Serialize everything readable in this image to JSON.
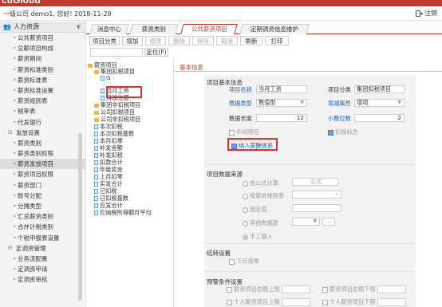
{
  "banner": {
    "title": "ctiGloud"
  },
  "header": {
    "welcome": "一级公司 demo1, 您好! 2018-11-29",
    "logout_label": "注销"
  },
  "sidebar": {
    "title": "人力资源",
    "items": [
      {
        "label": "公共薪资项目",
        "level": 2
      },
      {
        "label": "总额项目构成",
        "level": 2
      },
      {
        "label": "薪资期间",
        "level": 2
      },
      {
        "label": "薪资标准类别",
        "level": 2
      },
      {
        "label": "薪资标准表",
        "level": 2
      },
      {
        "label": "薪资标准设置",
        "level": 2
      },
      {
        "label": "薪资规则表",
        "level": 2
      },
      {
        "label": "税率表",
        "level": 2
      },
      {
        "label": "代发银行",
        "level": 2
      },
      {
        "label": "发放设置",
        "level": 1
      },
      {
        "label": "薪资类别",
        "level": 2
      },
      {
        "label": "薪资类别权限",
        "level": 2
      },
      {
        "label": "薪资发放项目",
        "level": 2,
        "active": true
      },
      {
        "label": "薪资项目权限",
        "level": 2
      },
      {
        "label": "薪资部门",
        "level": 2
      },
      {
        "label": "账号分配",
        "level": 2
      },
      {
        "label": "分摊类型",
        "level": 2
      },
      {
        "label": "汇总薪资类别",
        "level": 2
      },
      {
        "label": "合并计税类别",
        "level": 2
      },
      {
        "label": "个税申报表设置",
        "level": 2
      },
      {
        "label": "定调资管理",
        "level": 1
      },
      {
        "label": "业务流配置",
        "level": 2
      },
      {
        "label": "定调资申请",
        "level": 2
      },
      {
        "label": "定调资审批",
        "level": 2
      }
    ]
  },
  "tabs": [
    {
      "label": "消息中心",
      "active": false
    },
    {
      "label": "薪资类别",
      "active": false
    },
    {
      "label": "公共薪资项目",
      "active": true
    },
    {
      "label": "定期调资信息维护",
      "active": false
    }
  ],
  "toolbar": {
    "buttons": [
      {
        "label": "项目分类",
        "disabled": false
      },
      {
        "label": "增加",
        "disabled": false
      },
      {
        "label": "修改",
        "disabled": true
      },
      {
        "label": "删除",
        "disabled": true
      },
      {
        "label": "保存",
        "disabled": true
      },
      {
        "label": "取消",
        "disabled": true
      },
      {
        "label": "刷新",
        "disabled": false
      },
      {
        "label": "打印",
        "disabled": false
      }
    ]
  },
  "locate": {
    "button_label": "定位(F)"
  },
  "tree": {
    "nodes": [
      {
        "label": "薪资项目",
        "type": "folder",
        "indent": 0
      },
      {
        "label": "集团扣税项目",
        "type": "folder",
        "indent": 1
      },
      {
        "label": "G",
        "type": "doc",
        "indent": 2
      },
      {
        "label": "当月工资",
        "type": "doc",
        "indent": 2
      },
      {
        "label": "月税位置",
        "type": "doc",
        "indent": 2
      },
      {
        "label": "集团非扣税项目",
        "type": "folder",
        "indent": 1
      },
      {
        "label": "公司扣税项目",
        "type": "folder",
        "indent": 1
      },
      {
        "label": "公司非扣税项目",
        "type": "folder",
        "indent": 1
      },
      {
        "label": "本次扣税",
        "type": "doc",
        "indent": 1
      },
      {
        "label": "本次扣税基数",
        "type": "doc",
        "indent": 1
      },
      {
        "label": "本月扣零",
        "type": "doc",
        "indent": 1
      },
      {
        "label": "补发金额",
        "type": "doc",
        "indent": 1
      },
      {
        "label": "补发扣税",
        "type": "doc",
        "indent": 1
      },
      {
        "label": "扣款合计",
        "type": "doc",
        "indent": 1
      },
      {
        "label": "年度奖金",
        "type": "doc",
        "indent": 1
      },
      {
        "label": "上月扣零",
        "type": "doc",
        "indent": 1
      },
      {
        "label": "实发合计",
        "type": "doc",
        "indent": 1
      },
      {
        "label": "已扣税",
        "type": "doc",
        "indent": 1
      },
      {
        "label": "已扣税基数",
        "type": "doc",
        "indent": 1
      },
      {
        "label": "应发合计",
        "type": "doc",
        "indent": 1
      },
      {
        "label": "应纳税所得额月平均",
        "type": "doc",
        "indent": 1
      }
    ]
  },
  "content": {
    "tab_label": "基本信息",
    "basic": {
      "section_title": "项目基本信息",
      "name_label": "项目名称",
      "name_value": "当月工资",
      "category_label": "项目分类",
      "category_value": "集团扣税项目",
      "datatype_label": "数据类型",
      "datatype_value": "数值型",
      "increase_label": "增减属性",
      "increase_value": "增项",
      "length_label": "数据长度",
      "length_value": "12",
      "decimals_label": "小数位数",
      "decimals_value": "2",
      "mid_label": "中间项目",
      "taxflag_label": "扣税标志",
      "include_label": "纳入薪酬体系"
    },
    "source": {
      "section_title": "项目数据来源",
      "options": [
        "由公式计算",
        "按薪资规则表",
        "固定值",
        "其他数据源",
        "手工输入"
      ],
      "formula_button": "公式",
      "selected": "手工输入"
    },
    "carry": {
      "section_title": "结转设置",
      "clear_label": "下月清零"
    },
    "warn": {
      "section_title": "预警条件设置",
      "items": [
        "薪资项目总额上限",
        "薪资项目总额下限",
        "个人薪资项目上限",
        "个人薪资项目下限"
      ]
    }
  }
}
